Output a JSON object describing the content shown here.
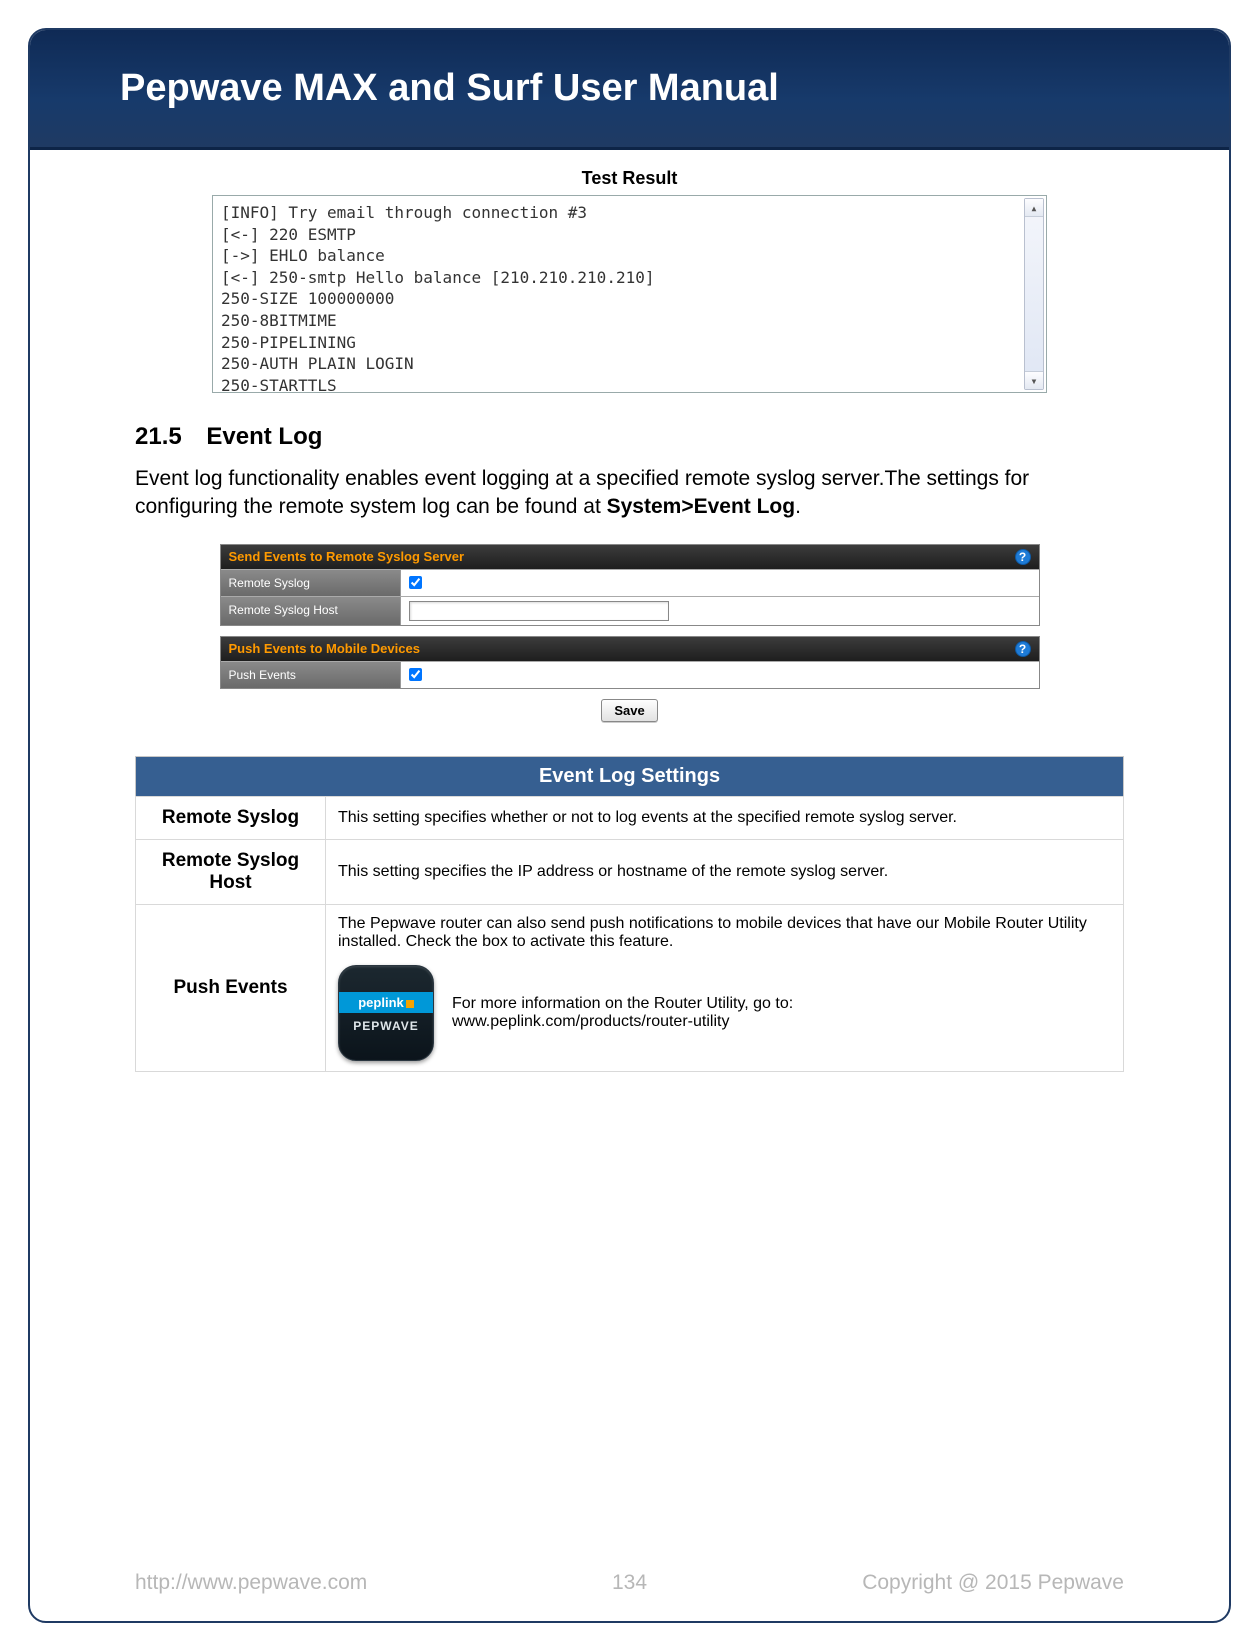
{
  "header": {
    "title": "Pepwave MAX and Surf User Manual"
  },
  "test_result": {
    "title": "Test Result",
    "lines": [
      "[INFO] Try email through connection #3",
      "[<-] 220 ESMTP",
      "[->] EHLO balance",
      "[<-] 250-smtp Hello balance [210.210.210.210]",
      "250-SIZE 100000000",
      "250-8BITMIME",
      "250-PIPELINING",
      "250-AUTH PLAIN LOGIN",
      "250-STARTTLS"
    ]
  },
  "section": {
    "number": "21.5",
    "title": "Event Log",
    "paragraph_prefix": "Event log functionality enables event logging at a specified remote syslog server.The settings for configuring the remote system log can be found at ",
    "paragraph_bold": "System>Event Log",
    "paragraph_suffix": "."
  },
  "settings_panels": {
    "panel1": {
      "header": "Send Events to Remote Syslog Server",
      "rows": {
        "row1_label": "Remote Syslog",
        "row1_checked": true,
        "row2_label": "Remote Syslog Host",
        "row2_value": ""
      }
    },
    "panel2": {
      "header": "Push Events to Mobile Devices",
      "rows": {
        "row1_label": "Push Events",
        "row1_checked": true
      }
    },
    "save_label": "Save"
  },
  "desc_table": {
    "header": "Event Log Settings",
    "rows": {
      "r1_label": "Remote Syslog",
      "r1_desc": "This setting specifies whether or not to log events at the specified remote syslog server.",
      "r2_label": "Remote Syslog Host",
      "r2_desc": "This setting specifies the IP address or hostname of the remote syslog server.",
      "r3_label": "Push Events",
      "r3_desc1": "The Pepwave router can also send push notifications to mobile devices that have our Mobile Router Utility installed. Check the box to activate this feature.",
      "r3_desc2a": "For more information on the Router Utility, go to:",
      "r3_desc2b": "www.peplink.com/products/router-utility",
      "app_icon": {
        "line1": "peplink",
        "line2": "PEPWAVE"
      }
    }
  },
  "footer": {
    "url": "http://www.pepwave.com",
    "page": "134",
    "copyright": "Copyright @ 2015 Pepwave"
  }
}
